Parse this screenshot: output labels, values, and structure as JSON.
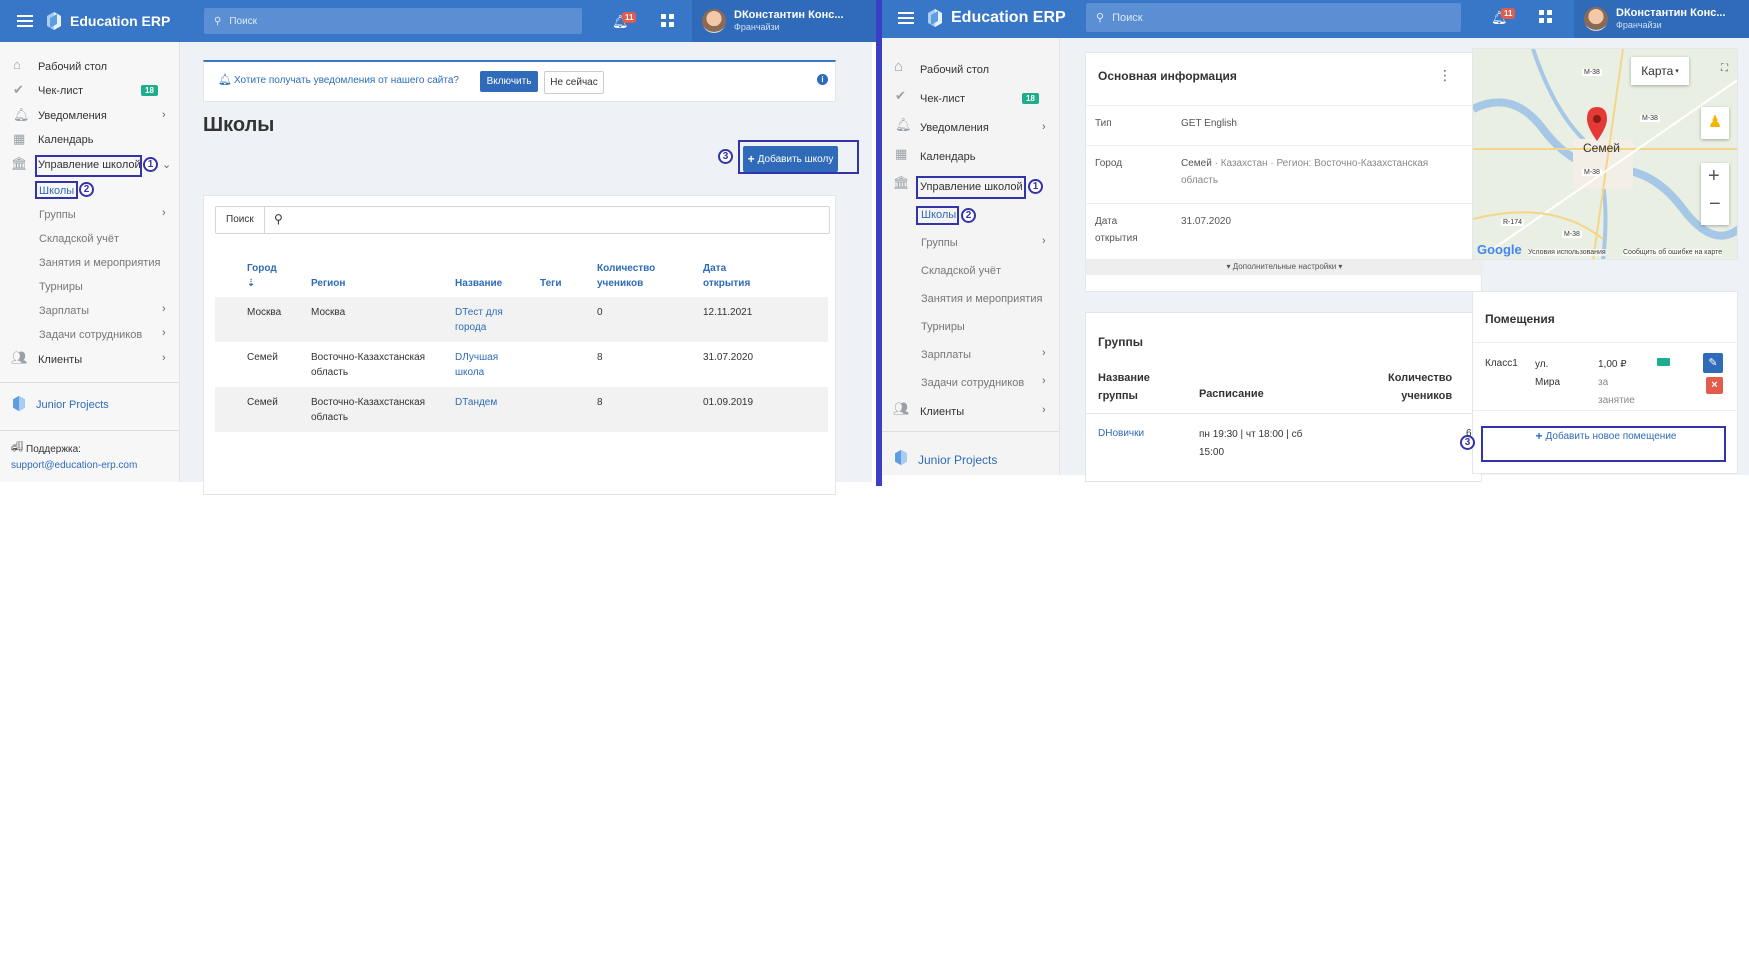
{
  "left": {
    "brand": "Education ERP",
    "search_placeholder": "Поиск",
    "notif_count": "11",
    "user_name": "DКонстантин Конс...",
    "user_role": "Франчайзи",
    "nav": {
      "desktop": "Рабочий стол",
      "checklist": "Чек-лист",
      "checklist_count": "18",
      "notifications": "Уведомления",
      "calendar": "Календарь",
      "school_mgmt": "Управление школой",
      "schools": "Школы",
      "groups": "Группы",
      "warehouse": "Складской учёт",
      "lessons": "Занятия и мероприятия",
      "tournaments": "Турниры",
      "salaries": "Зарплаты",
      "staff_tasks": "Задачи сотрудников",
      "clients": "Клиенты",
      "junior": "Junior Projects",
      "support_label": "Поддержка:",
      "support_email": "support@education-erp.com"
    },
    "banner": {
      "text": "Хотите получать уведомления от нашего сайта?",
      "enable": "Включить",
      "later": "Не сейчас"
    },
    "page_title": "Школы",
    "add_school": "Добавить школу",
    "search_label": "Поиск",
    "table": {
      "headers": {
        "city": "Город",
        "region": "Регион",
        "name": "Название",
        "tags": "Теги",
        "students1": "Количество",
        "students2": "учеников",
        "opened1": "Дата",
        "opened2": "открытия"
      },
      "rows": [
        {
          "city": "Москва",
          "region1": "Москва",
          "region2": "",
          "name1": "DТест для",
          "name2": "города",
          "students": "0",
          "opened": "12.11.2021"
        },
        {
          "city": "Семей",
          "region1": "Восточно-Казахстанская",
          "region2": "область",
          "name1": "DЛучшая",
          "name2": "школа",
          "students": "8",
          "opened": "31.07.2020"
        },
        {
          "city": "Семей",
          "region1": "Восточно-Казахстанская",
          "region2": "область",
          "name1": "DТандем",
          "name2": "",
          "students": "8",
          "opened": "01.09.2019"
        }
      ]
    },
    "markers": [
      "1",
      "2",
      "3"
    ]
  },
  "right": {
    "brand": "Education ERP",
    "search_placeholder": "Поиск",
    "notif_count": "11",
    "user_name": "DКонстантин Конс...",
    "user_role": "Франчайзи",
    "nav": {
      "desktop": "Рабочий стол",
      "checklist": "Чек-лист",
      "checklist_count": "18",
      "notifications": "Уведомления",
      "calendar": "Календарь",
      "school_mgmt": "Управление школой",
      "schools": "Школы",
      "groups": "Группы",
      "warehouse": "Складской учёт",
      "lessons": "Занятия и мероприятия",
      "tournaments": "Турниры",
      "salaries": "Зарплаты",
      "staff_tasks": "Задачи сотрудников",
      "clients": "Клиенты",
      "junior": "Junior Projects"
    },
    "info": {
      "title": "Основная информация",
      "type_label": "Тип",
      "type_value": "GET English",
      "city_label": "Город",
      "city_value1": "Семей",
      "city_value_rest": " · Казахстан · Регион: Восточно-Казахстанская",
      "city_value2": "область",
      "date_label1": "Дата",
      "date_label2": "открытия",
      "date_value": "31.07.2020",
      "more": "▾ Дополнительные настройки ▾"
    },
    "groups": {
      "title": "Группы",
      "h_name1": "Название",
      "h_name2": "группы",
      "h_schedule": "Расписание",
      "h_count1": "Количество",
      "h_count2": "учеников",
      "row_name": "DНовички",
      "row_schedule1": "пн 19:30 | чт 18:00 | сб",
      "row_schedule2": "15:00",
      "row_count": "6"
    },
    "map": {
      "type": "Карта",
      "city": "Семей",
      "google": "Google",
      "terms": "Условия использования",
      "report": "Сообщить об ошибке на карте",
      "roads": [
        "М-38",
        "М-38",
        "М-38",
        "R-174",
        "М-38"
      ]
    },
    "rooms": {
      "title": "Помещения",
      "name": "Класс1",
      "addr1": "ул.",
      "addr2": "Мира",
      "price1": "1,00 ₽",
      "price2": "за",
      "price3": "занятие",
      "add": "Добавить новое помещение"
    },
    "markers": [
      "1",
      "2",
      "3"
    ]
  }
}
